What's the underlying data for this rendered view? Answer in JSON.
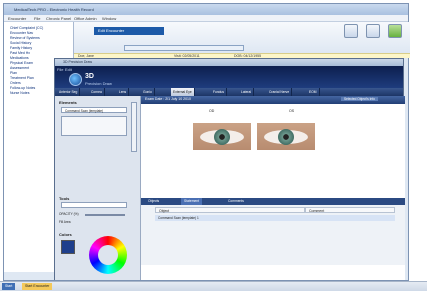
{
  "window": {
    "title": "MedicalTech.PRO - Electronic Health Record"
  },
  "menu": [
    "Encounter",
    "File",
    "Chronic Panel",
    "Office Admin",
    "Window"
  ],
  "tree": [
    "Chief Complaint (CC)",
    "Encounter Nav",
    "Review of Systems",
    "Social History",
    "Family History",
    "Past Med Hx",
    "Medications",
    "Physical Exam",
    "Assessment",
    "Plan",
    "Treatment Plan",
    "Orders",
    "Follow-up Notes",
    "Nurse Notes"
  ],
  "encounter": {
    "label": "Edit Encounter"
  },
  "patient": {
    "name_label": "Doe, Jane",
    "visit_label": "Visit: 02/05/2011",
    "date_label": "DOB: 04/12/1955"
  },
  "precision": {
    "window_title": "3D Precision Draw",
    "menu": [
      "File",
      "Edit"
    ],
    "logo_title": "3D",
    "logo_subtitle": "Precision Draw",
    "nav": [
      "Anterior Seg",
      "Cornea",
      "Lens",
      "Gonio",
      "External Eye",
      "Fundus",
      "Lateral",
      "Cranial Nerve",
      "EOM"
    ],
    "nav_selected_index": 4,
    "elements_label": "Elements",
    "command_label": "Command Scan (template)",
    "tools_label": "Tools",
    "opacity_label": "OPACITY (%)",
    "fill_label": "Fill Area",
    "colors_label": "Colors",
    "content_bar": "Exam Date : 2/1 July 10 2010",
    "content_bar_right": "Selected Object's Info",
    "labels": [
      "OD",
      "OS"
    ],
    "tabs": [
      "Objects",
      "Statement",
      "Comments"
    ],
    "grid_cols": [
      "Object",
      "Comment"
    ],
    "grid_row": "Command Scan (template) 1"
  },
  "taskbar": {
    "start": "Start",
    "item": "Start Encounter"
  }
}
